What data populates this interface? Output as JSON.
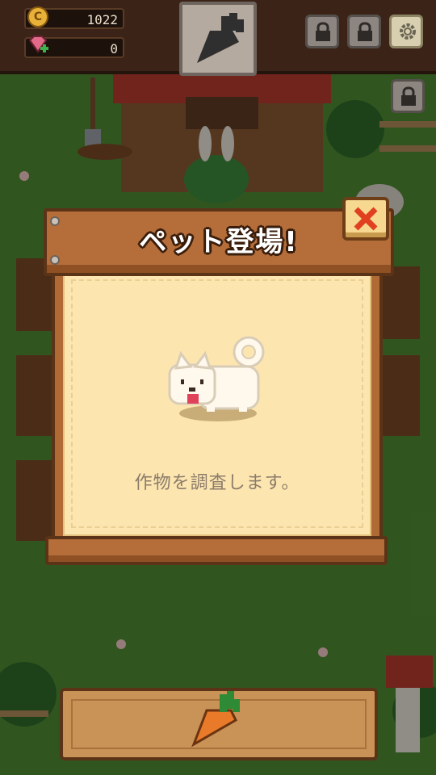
{
  "hud": {
    "coins": "1022",
    "gems": "0",
    "coin_icon": "coin-icon",
    "gem_icon": "gem-icon",
    "center_slot_icon": "carrot-icon",
    "lock_icons": [
      "lock-icon",
      "lock-icon",
      "lock-icon"
    ],
    "settings_icon": "gear-icon"
  },
  "modal": {
    "title": "ペット登場!",
    "message": "作物を調査します。",
    "close_icon": "close-x-icon",
    "pet_icon": "white-dog-icon"
  },
  "bottom_panel": {
    "icon": "carrot-icon"
  },
  "colors": {
    "modal_wood": "#b56e3a",
    "modal_paper": "#fde5b0",
    "close_x": "#e0401f",
    "hud": "#3b2417",
    "grass": "#3f6b2a"
  }
}
